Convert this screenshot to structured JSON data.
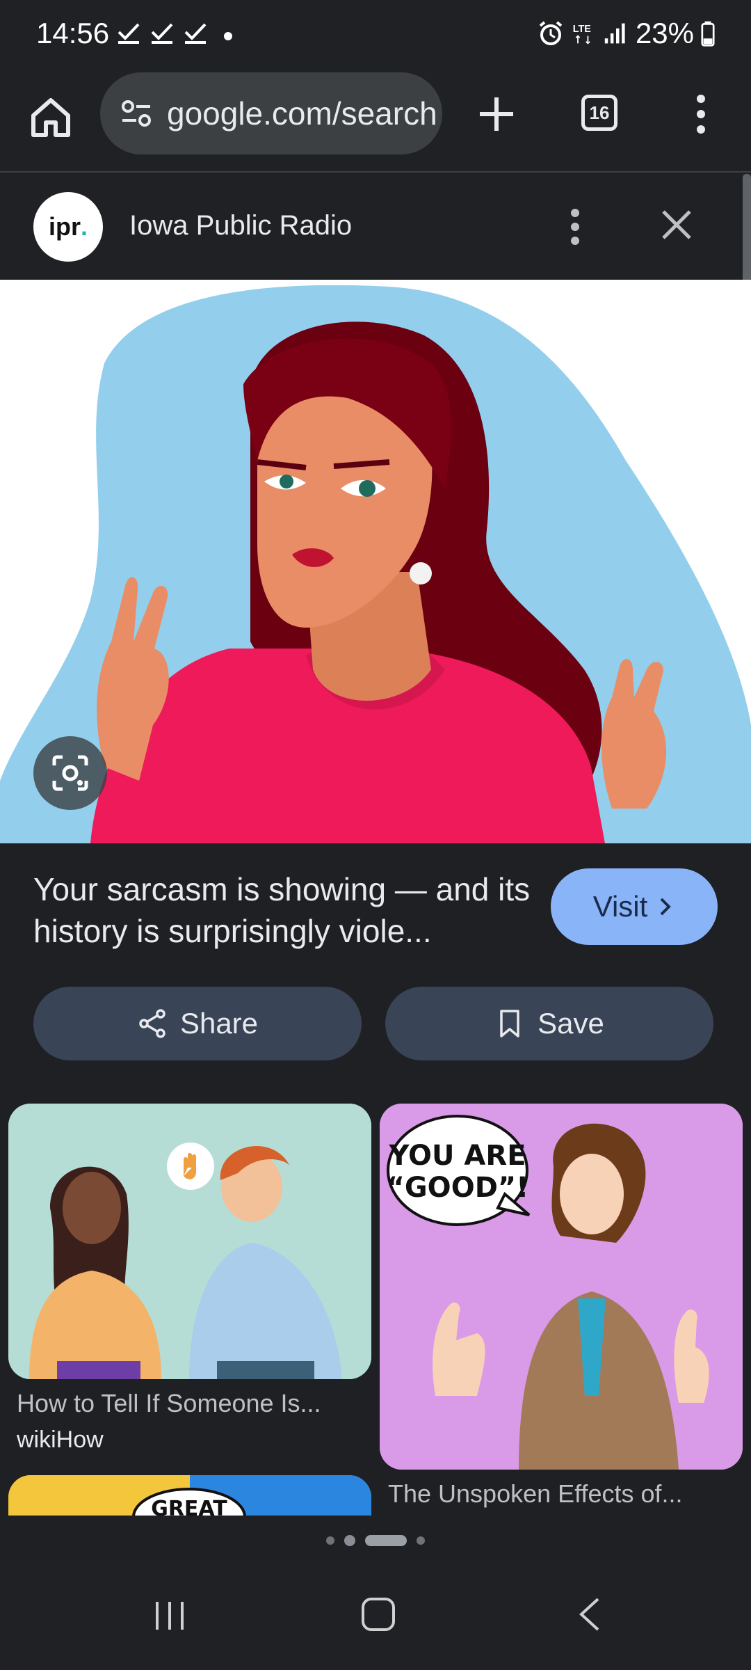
{
  "status_bar": {
    "time": "14:56",
    "battery_percent": "23%",
    "network": "LTE"
  },
  "browser": {
    "url": "google.com/search",
    "tab_count": "16"
  },
  "source": {
    "logo_text": "ipr",
    "logo_dot": ".",
    "name": "Iowa Public Radio"
  },
  "result": {
    "caption": "Your sarcasm is showing — and its history is surprisingly viole...",
    "visit_label": "Visit",
    "share_label": "Share",
    "save_label": "Save"
  },
  "related": [
    {
      "title": "How to Tell If Someone Is...",
      "source": "wikiHow"
    },
    {
      "title": "The Unspoken Effects of...",
      "bubble_text_1": "YOU ARE",
      "bubble_text_2": "“GOOD”!"
    },
    {
      "bubble_text": "GREAT"
    }
  ],
  "colors": {
    "background": "#1f2023",
    "accent_visit": "#8ab4f8",
    "action_button": "#394457",
    "hero_sky": "#93cfec",
    "hero_shirt": "#ee1a5a"
  }
}
